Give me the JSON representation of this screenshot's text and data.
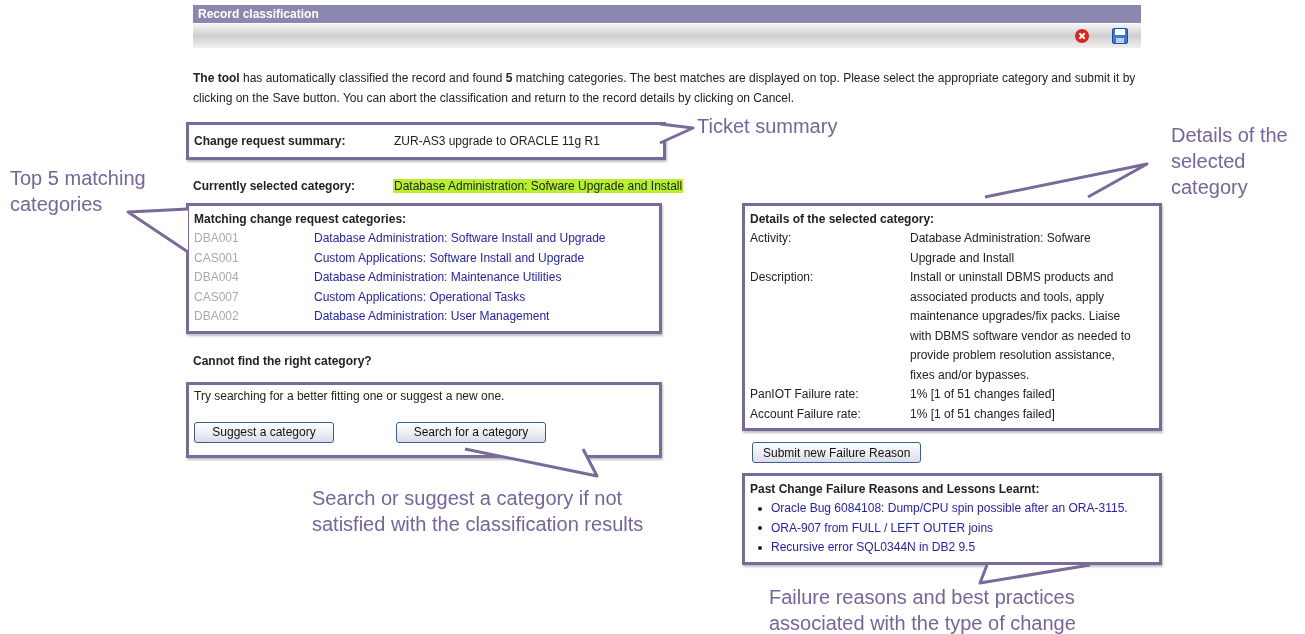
{
  "window": {
    "title": "Record classification"
  },
  "intro": "**The tool** has automatically classified the record and found **5** matching categories. The best matches are displayed on top. Please select the appropriate category and submit it by clicking on the Save button. You can abort the classification and return to the record details by clicking on Cancel.",
  "summary": {
    "label": "Change request summary:",
    "value": "ZUR-AS3 upgrade to ORACLE 11g R1"
  },
  "selected_category": {
    "label": "Currently selected category:",
    "value": "Database Administration: Sofware Upgrade and Install"
  },
  "matching": {
    "title": "Matching change request categories:",
    "items": [
      {
        "code": "DBA001",
        "name": "Database Administration: Software Install and Upgrade"
      },
      {
        "code": "CAS001",
        "name": "Custom Applications: Software Install and Upgrade"
      },
      {
        "code": "DBA004",
        "name": "Database Administration: Maintenance Utilities"
      },
      {
        "code": "CAS007",
        "name": "Custom Applications: Operational Tasks"
      },
      {
        "code": "DBA002",
        "name": "Database Administration: User Management"
      }
    ]
  },
  "cannot_find": {
    "title": "Cannot find the right category?",
    "text": "Try searching for a better fitting one or suggest a new one.",
    "buttons": [
      "Suggest a category",
      "Search for a category"
    ]
  },
  "details": {
    "title": "Details of the selected category:",
    "rows": [
      {
        "label": "Activity:",
        "value": "Database Administration: Sofware Upgrade and Install"
      },
      {
        "label": "Description:",
        "value": "Install or uninstall DBMS products and associated products and tools, apply maintenance upgrades/fix packs. Liaise with DBMS software vendor as needed to provide problem resolution assistance, fixes and/or bypasses."
      },
      {
        "label": "PanIOT Failure rate:",
        "value": "1% [1 of 51 changes failed]"
      },
      {
        "label": "Account Failure rate:",
        "value": "1% [1 of 51 changes failed]"
      }
    ]
  },
  "submit_button": "Submit new Failure Reason",
  "failures": {
    "title": "Past Change Failure Reasons and Lessons Learnt:",
    "items": [
      "Oracle Bug 6084108: Dump/CPU spin possible after an ORA-3115.",
      "ORA-907 from FULL / LEFT OUTER joins",
      "Recursive error SQL0344N in DB2 9.5"
    ]
  },
  "annotations": [
    {
      "text": "Ticket summary"
    },
    {
      "text": "Details of the selected category"
    },
    {
      "text": "Top 5 matching categories"
    },
    {
      "text": "Search or suggest a category if not satisfied with the classification results"
    },
    {
      "text": "Failure reasons and best practices associated with the type of change"
    }
  ]
}
